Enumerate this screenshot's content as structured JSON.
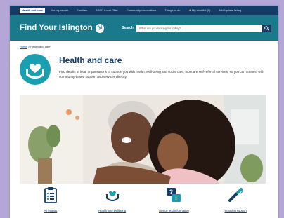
{
  "top_nav": {
    "items": [
      {
        "label": "Health and care",
        "active": true
      },
      {
        "label": "Young people",
        "active": false
      },
      {
        "label": "Families",
        "active": false
      },
      {
        "label": "SEND Local Offer",
        "active": false
      },
      {
        "label": "Community connections",
        "active": false
      },
      {
        "label": "Things to do",
        "active": false
      },
      {
        "label": "My shortlist (0)",
        "active": false,
        "icon": "star-icon"
      },
      {
        "label": "Add/update listing",
        "active": false
      }
    ]
  },
  "header": {
    "brand": "Find Your Islington",
    "logo_text": "fyi",
    "search_label": "Search",
    "search_placeholder": "What are you looking for today?",
    "search_button_icon": "search-icon"
  },
  "breadcrumb": {
    "home": "Home",
    "separator": ">",
    "current": "Health and care"
  },
  "intro": {
    "icon": "heart-hands-icon",
    "title": "Health and care",
    "description": "Find details of local organisations to support you with health, well-being and social care, most are self-referral services, so you can connect with community-based support and services directly."
  },
  "hero": {
    "image": "two-women-hugging-photo"
  },
  "categories": [
    {
      "label": "All listings",
      "icon": "clipboard-list-icon"
    },
    {
      "label": "Health and wellbeing",
      "icon": "heart-hands-icon"
    },
    {
      "label": "Advice and information",
      "icon": "help-info-icon"
    },
    {
      "label": "Smoking support",
      "icon": "no-smoking-icon"
    }
  ],
  "colors": {
    "page_background": "#b5a6d8",
    "top_nav": "#143c66",
    "header": "#1a7a8c",
    "title": "#143c66",
    "accent_teal": "#1a9fb0"
  }
}
